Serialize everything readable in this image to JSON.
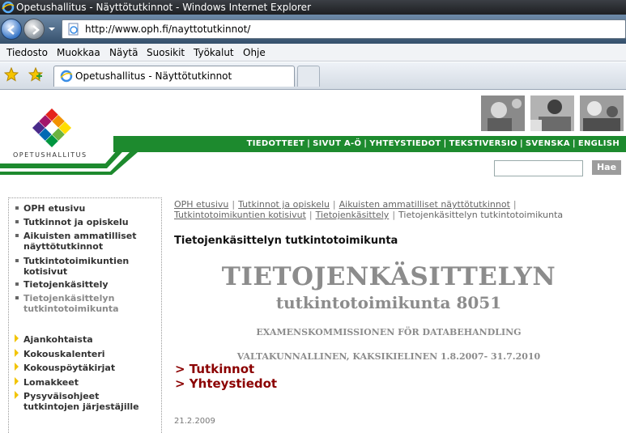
{
  "browser": {
    "window_title": "Opetushallitus - Näyttötutkinnot - Windows Internet Explorer",
    "address": "http://www.oph.fi/nayttotutkinnot/",
    "menu": [
      "Tiedosto",
      "Muokkaa",
      "Näytä",
      "Suosikit",
      "Työkalut",
      "Ohje"
    ],
    "tab_title": "Opetushallitus - Näyttötutkinnot"
  },
  "site": {
    "logo_text": "OPETUSHALLITUS",
    "top_links": [
      "TIEDOTTEET",
      "SIVUT A-Ö",
      "YHTEYSTIEDOT",
      "TEKSTIVERSIO",
      "SVENSKA",
      "ENGLISH"
    ],
    "search_button": "Hae"
  },
  "sidebar": {
    "primary": [
      {
        "label": "OPH etusivu"
      },
      {
        "label": "Tutkinnot ja opiskelu"
      },
      {
        "label": "Aikuisten ammatilliset näyttötutkinnot"
      },
      {
        "label": "Tutkintotoimikuntien kotisivut"
      },
      {
        "label": "Tietojenkäsittely"
      },
      {
        "label": "Tietojenkäsittelyn tutkintotoimikunta"
      }
    ],
    "secondary": [
      {
        "label": "Ajankohtaista"
      },
      {
        "label": "Kokouskalenteri"
      },
      {
        "label": "Kokouspöytäkirjat"
      },
      {
        "label": "Lomakkeet"
      },
      {
        "label": "Pysyväisohjeet tutkintojen järjestäjille"
      }
    ]
  },
  "breadcrumb": {
    "items": [
      "OPH etusivu",
      "Tutkinnot ja opiskelu",
      "Aikuisten ammatilliset näyttötutkinnot",
      "Tutkintotoimikuntien kotisivut",
      "Tietojenkäsittely"
    ],
    "current": "Tietojenkäsittelyn tutkintotoimikunta",
    "separator": "|"
  },
  "main": {
    "page_title": "Tietojenkäsittelyn tutkintotoimikunta",
    "big_title": "TIETOJENKÄSITTELYN",
    "sub_title": "tutkintotoimikunta 8051",
    "swedish_title": "EXAMENSKOMMISSIONEN FÖR DATABEHANDLING",
    "period": "VALTAKUNNALLINEN, KAKSIKIELINEN 1.8.2007- 31.7.2010",
    "links": [
      "> Tutkinnot",
      "> Yhteystiedot"
    ],
    "date": "21.2.2009"
  },
  "colors": {
    "brand_green": "#1d8a2e",
    "link_red": "#8b0000",
    "title_gray": "#8c8c8c"
  }
}
